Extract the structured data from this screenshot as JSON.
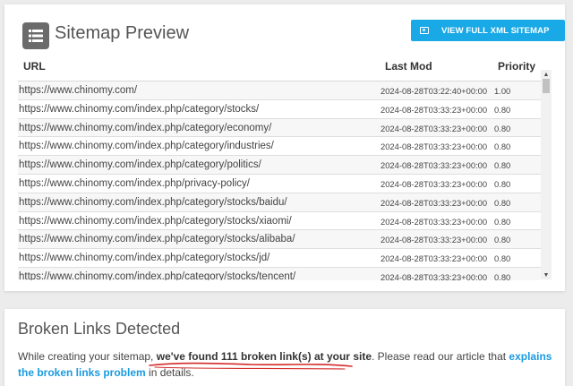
{
  "sitemap": {
    "title": "Sitemap Preview",
    "button_label": "VIEW FULL XML SITEMAP",
    "columns": {
      "url": "URL",
      "lastmod": "Last Mod",
      "priority": "Priority"
    },
    "rows": [
      {
        "url": "https://www.chinomy.com/",
        "lastmod": "2024-08-28T03:22:40+00:00",
        "priority": "1.00"
      },
      {
        "url": "https://www.chinomy.com/index.php/category/stocks/",
        "lastmod": "2024-08-28T03:33:23+00:00",
        "priority": "0.80"
      },
      {
        "url": "https://www.chinomy.com/index.php/category/economy/",
        "lastmod": "2024-08-28T03:33:23+00:00",
        "priority": "0.80"
      },
      {
        "url": "https://www.chinomy.com/index.php/category/industries/",
        "lastmod": "2024-08-28T03:33:23+00:00",
        "priority": "0.80"
      },
      {
        "url": "https://www.chinomy.com/index.php/category/politics/",
        "lastmod": "2024-08-28T03:33:23+00:00",
        "priority": "0.80"
      },
      {
        "url": "https://www.chinomy.com/index.php/privacy-policy/",
        "lastmod": "2024-08-28T03:33:23+00:00",
        "priority": "0.80"
      },
      {
        "url": "https://www.chinomy.com/index.php/category/stocks/baidu/",
        "lastmod": "2024-08-28T03:33:23+00:00",
        "priority": "0.80"
      },
      {
        "url": "https://www.chinomy.com/index.php/category/stocks/xiaomi/",
        "lastmod": "2024-08-28T03:33:23+00:00",
        "priority": "0.80"
      },
      {
        "url": "https://www.chinomy.com/index.php/category/stocks/alibaba/",
        "lastmod": "2024-08-28T03:33:23+00:00",
        "priority": "0.80"
      },
      {
        "url": "https://www.chinomy.com/index.php/category/stocks/jd/",
        "lastmod": "2024-08-28T03:33:23+00:00",
        "priority": "0.80"
      },
      {
        "url": "https://www.chinomy.com/index.php/category/stocks/tencent/",
        "lastmod": "2024-08-28T03:33:23+00:00",
        "priority": "0.80"
      }
    ]
  },
  "broken": {
    "title": "Broken Links Detected",
    "text_before": "While creating your sitemap, ",
    "highlight": "we've found 111 broken link(s) at your site",
    "text_middle": ". Please read our article that ",
    "link": "explains the broken links problem",
    "text_after": " in details."
  },
  "icons": {
    "header": "list-icon",
    "button": "image-icon",
    "scroll_up": "arrow-up-icon",
    "scroll_down": "arrow-down-icon"
  },
  "colors": {
    "accent": "#18a9e6",
    "link": "#1a9be0",
    "annotation": "#d42a2a",
    "header_icon_bg": "#6b6b6b"
  }
}
